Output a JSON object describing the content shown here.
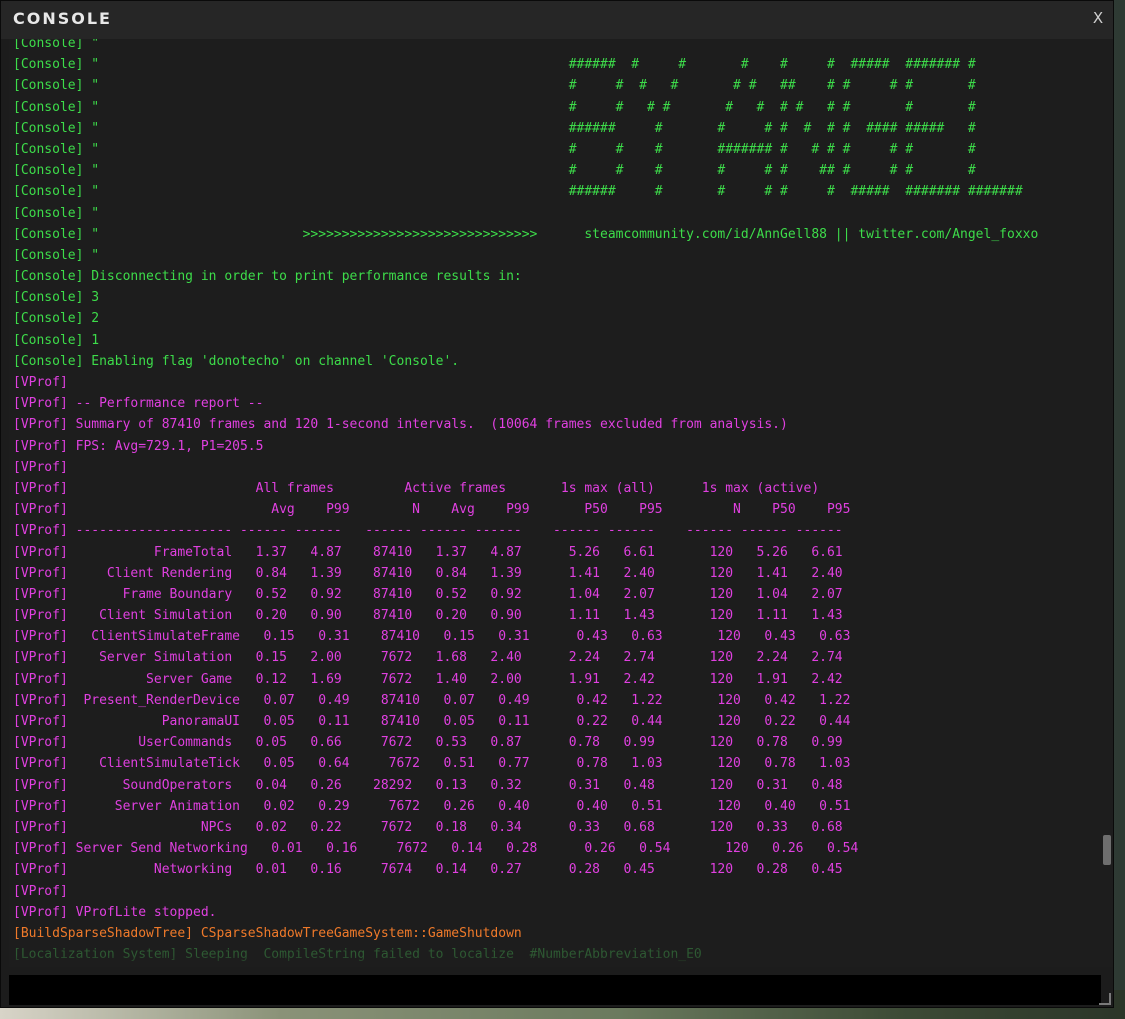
{
  "window": {
    "title": "CONSOLE",
    "close_label": "X"
  },
  "colors": {
    "console_text": "#3ddc4a",
    "vprof_text": "#e040e0",
    "build_text": "#f07a2a",
    "background": "#1d1d1d"
  },
  "log": [
    {
      "type": "console",
      "text": "[Console] \""
    },
    {
      "type": "console",
      "text": "[Console] \"                                                            ######  #     #       #    #     #  #####  ####### #"
    },
    {
      "type": "console",
      "text": "[Console] \"                                                            #     #  #   #       # #   ##    # #     # #       #"
    },
    {
      "type": "console",
      "text": "[Console] \"                                                            #     #   # #       #   #  # #   # #       #       #"
    },
    {
      "type": "console",
      "text": "[Console] \"                                                            ######     #       #     # #  #  # #  #### #####   #"
    },
    {
      "type": "console",
      "text": "[Console] \"                                                            #     #    #       ####### #   # # #     # #       #"
    },
    {
      "type": "console",
      "text": "[Console] \"                                                            #     #    #       #     # #    ## #     # #       #"
    },
    {
      "type": "console",
      "text": "[Console] \"                                                            ######     #       #     # #     #  #####  ####### #######"
    },
    {
      "type": "console",
      "text": "[Console] \""
    },
    {
      "type": "console",
      "text": "[Console] \"                          >>>>>>>>>>>>>>>>>>>>>>>>>>>>>>      steamcommunity.com/id/AnnGell88 || twitter.com/Angel_foxxo"
    },
    {
      "type": "console",
      "text": "[Console] \""
    },
    {
      "type": "console",
      "text": "[Console] Disconnecting in order to print performance results in:"
    },
    {
      "type": "console",
      "text": "[Console] 3"
    },
    {
      "type": "console",
      "text": "[Console] 2"
    },
    {
      "type": "console",
      "text": "[Console] 1"
    },
    {
      "type": "console",
      "text": "[Console] Enabling flag 'donotecho' on channel 'Console'."
    },
    {
      "type": "vprof",
      "text": "[VProf]"
    },
    {
      "type": "vprof",
      "text": "[VProf] -- Performance report --"
    },
    {
      "type": "vprof",
      "text": "[VProf] Summary of 87410 frames and 120 1-second intervals.  (10064 frames excluded from analysis.)"
    },
    {
      "type": "vprof",
      "text": "[VProf] FPS: Avg=729.1, P1=205.5"
    },
    {
      "type": "vprof",
      "text": "[VProf]"
    },
    {
      "type": "vprof",
      "text": "[VProf]                        All frames         Active frames       1s max (all)      1s max (active)"
    },
    {
      "type": "vprof",
      "text": "[VProf]                          Avg    P99        N    Avg    P99       P50    P95         N    P50    P95"
    },
    {
      "type": "vprof",
      "text": "[VProf] -------------------- ------ ------   ------ ------ ------    ------ ------    ------ ------ ------"
    },
    {
      "type": "vprof",
      "text": "[VProf]           FrameTotal   1.37   4.87    87410   1.37   4.87      5.26   6.61       120   5.26   6.61"
    },
    {
      "type": "vprof",
      "text": "[VProf]     Client Rendering   0.84   1.39    87410   0.84   1.39      1.41   2.40       120   1.41   2.40"
    },
    {
      "type": "vprof",
      "text": "[VProf]       Frame Boundary   0.52   0.92    87410   0.52   0.92      1.04   2.07       120   1.04   2.07"
    },
    {
      "type": "vprof",
      "text": "[VProf]    Client Simulation   0.20   0.90    87410   0.20   0.90      1.11   1.43       120   1.11   1.43"
    },
    {
      "type": "vprof",
      "text": "[VProf]   ClientSimulateFrame   0.15   0.31    87410   0.15   0.31      0.43   0.63       120   0.43   0.63"
    },
    {
      "type": "vprof",
      "text": "[VProf]    Server Simulation   0.15   2.00     7672   1.68   2.40      2.24   2.74       120   2.24   2.74"
    },
    {
      "type": "vprof",
      "text": "[VProf]          Server Game   0.12   1.69     7672   1.40   2.00      1.91   2.42       120   1.91   2.42"
    },
    {
      "type": "vprof",
      "text": "[VProf]  Present_RenderDevice   0.07   0.49    87410   0.07   0.49      0.42   1.22       120   0.42   1.22"
    },
    {
      "type": "vprof",
      "text": "[VProf]            PanoramaUI   0.05   0.11    87410   0.05   0.11      0.22   0.44       120   0.22   0.44"
    },
    {
      "type": "vprof",
      "text": "[VProf]         UserCommands   0.05   0.66     7672   0.53   0.87      0.78   0.99       120   0.78   0.99"
    },
    {
      "type": "vprof",
      "text": "[VProf]    ClientSimulateTick   0.05   0.64     7672   0.51   0.77      0.78   1.03       120   0.78   1.03"
    },
    {
      "type": "vprof",
      "text": "[VProf]       SoundOperators   0.04   0.26    28292   0.13   0.32      0.31   0.48       120   0.31   0.48"
    },
    {
      "type": "vprof",
      "text": "[VProf]      Server Animation   0.02   0.29     7672   0.26   0.40      0.40   0.51       120   0.40   0.51"
    },
    {
      "type": "vprof",
      "text": "[VProf]                 NPCs   0.02   0.22     7672   0.18   0.34      0.33   0.68       120   0.33   0.68"
    },
    {
      "type": "vprof",
      "text": "[VProf] Server Send Networking   0.01   0.16     7672   0.14   0.28      0.26   0.54       120   0.26   0.54"
    },
    {
      "type": "vprof",
      "text": "[VProf]           Networking   0.01   0.16     7674   0.14   0.27      0.28   0.45       120   0.28   0.45"
    },
    {
      "type": "vprof",
      "text": "[VProf]"
    },
    {
      "type": "vprof",
      "text": "[VProf] VProfLite stopped."
    },
    {
      "type": "build",
      "text": "[BuildSparseShadowTree] CSparseShadowTreeGameSystem::GameShutdown"
    },
    {
      "type": "faded",
      "text": "[Localization System] Sleeping  CompileString failed to localize  #NumberAbbreviation_E0"
    }
  ],
  "input": {
    "value": "",
    "placeholder": ""
  }
}
